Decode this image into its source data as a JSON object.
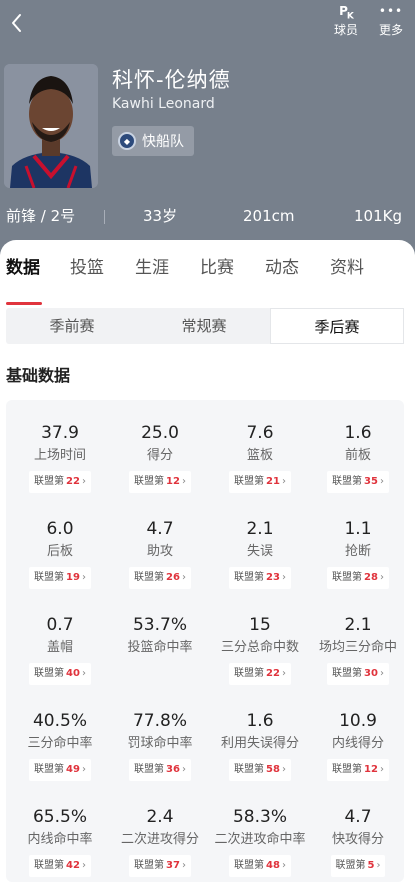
{
  "top_bar": {
    "pk_label": "球员",
    "more_label": "更多"
  },
  "player": {
    "name_cn": "科怀-伦纳德",
    "name_en": "Kawhi Leonard",
    "team": "快船队",
    "position": "前锋 / 2号",
    "age": "33岁",
    "height": "201cm",
    "weight": "101Kg"
  },
  "tabs": [
    "数据",
    "投篮",
    "生涯",
    "比赛",
    "动态",
    "资料"
  ],
  "season_types": [
    "季前赛",
    "常规赛",
    "季后赛"
  ],
  "active_season_type": "季后赛",
  "section_title": "基础数据",
  "rank_prefix": "联盟第",
  "stats": [
    {
      "value": "37.9",
      "label": "上场时间",
      "rank": "22"
    },
    {
      "value": "25.0",
      "label": "得分",
      "rank": "12"
    },
    {
      "value": "7.6",
      "label": "篮板",
      "rank": "21"
    },
    {
      "value": "1.6",
      "label": "前板",
      "rank": "35"
    },
    {
      "value": "6.0",
      "label": "后板",
      "rank": "19"
    },
    {
      "value": "4.7",
      "label": "助攻",
      "rank": "26"
    },
    {
      "value": "2.1",
      "label": "失误",
      "rank": "23"
    },
    {
      "value": "1.1",
      "label": "抢断",
      "rank": "28"
    },
    {
      "value": "0.7",
      "label": "盖帽",
      "rank": "40"
    },
    {
      "value": "53.7%",
      "label": "投篮命中率",
      "rank": ""
    },
    {
      "value": "15",
      "label": "三分总命中数",
      "rank": "22"
    },
    {
      "value": "2.1",
      "label": "场均三分命中",
      "rank": "30"
    },
    {
      "value": "40.5%",
      "label": "三分命中率",
      "rank": "49"
    },
    {
      "value": "77.8%",
      "label": "罚球命中率",
      "rank": "36"
    },
    {
      "value": "1.6",
      "label": "利用失误得分",
      "rank": "58"
    },
    {
      "value": "10.9",
      "label": "内线得分",
      "rank": "12"
    },
    {
      "value": "65.5%",
      "label": "内线命中率",
      "rank": "42"
    },
    {
      "value": "2.4",
      "label": "二次进攻得分",
      "rank": "37"
    },
    {
      "value": "58.3%",
      "label": "二次进攻命中率",
      "rank": "48"
    },
    {
      "value": "4.7",
      "label": "快攻得分",
      "rank": "5"
    }
  ],
  "colors": {
    "header_bg": "#77808c",
    "accent": "#e0343d"
  }
}
